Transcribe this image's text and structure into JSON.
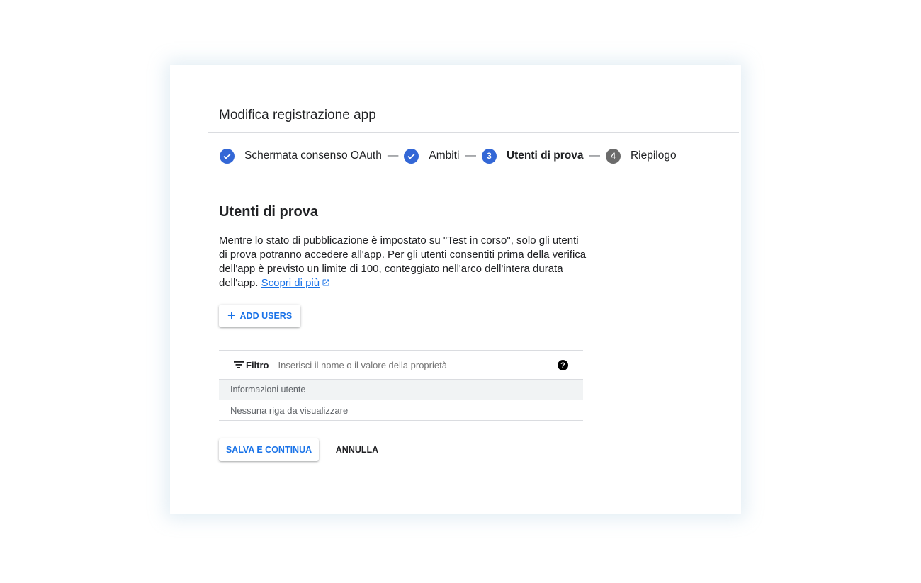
{
  "dialog": {
    "title": "Modifica registrazione app"
  },
  "stepper": {
    "steps": [
      {
        "label": "Schermata consenso OAuth",
        "state": "completed",
        "icon": "check-icon"
      },
      {
        "label": "Ambiti",
        "state": "completed",
        "icon": "check-icon"
      },
      {
        "label": "Utenti di prova",
        "state": "active",
        "number": "3"
      },
      {
        "label": "Riepilogo",
        "state": "pending",
        "number": "4"
      }
    ],
    "separator": "—"
  },
  "section": {
    "title": "Utenti di prova",
    "description": "Mentre lo stato di pubblicazione è impostato su \"Test in corso\", solo gli utenti di prova potranno accedere all'app. Per gli utenti consentiti prima della verifica dell'app è previsto un limite di 100, conteggiato nell'arco dell'intera durata dell'app.",
    "learn_more_link": "Scopri di più"
  },
  "add_users_button": {
    "label": "ADD USERS",
    "icon": "plus-icon"
  },
  "table": {
    "filter_label": "Filtro",
    "filter_placeholder": "Inserisci il nome o il valore della proprietà",
    "help_icon": "?",
    "columns": [
      "Informazioni utente"
    ],
    "empty_message": "Nessuna riga da visualizzare"
  },
  "actions": {
    "save_label": "SALVA E CONTINUA",
    "cancel_label": "ANNULLA"
  },
  "colors": {
    "accent": "#1a73e8",
    "step_pending": "#6b6b6b",
    "divider": "#dadce0"
  }
}
